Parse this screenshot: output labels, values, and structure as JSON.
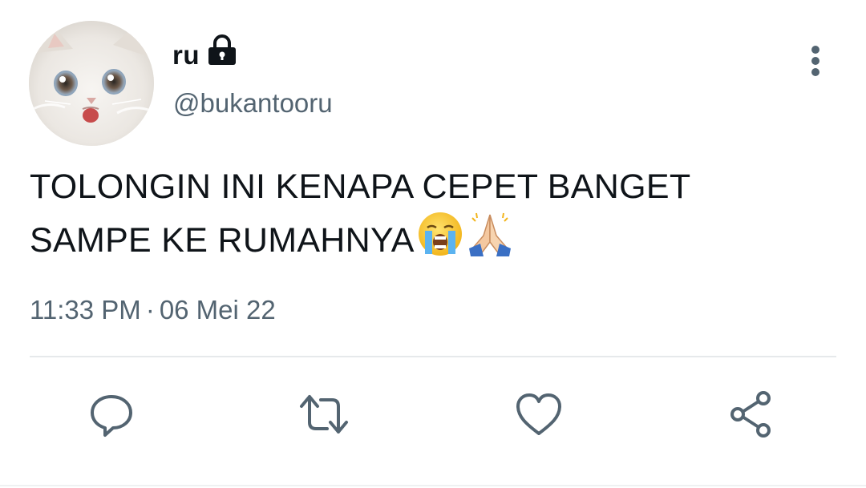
{
  "user": {
    "display_name": "ru",
    "handle": "@bukantooru",
    "protected": true,
    "avatar": "white-kitten-avatar"
  },
  "tweet": {
    "text_line1": "TOLONGIN INI KENAPA CEPET BANGET",
    "text_line2": "SAMPE KE RUMAHNYA",
    "emojis": [
      "loudly-crying-face",
      "folded-hands"
    ],
    "time": "11:33 PM",
    "separator": "·",
    "date": "06 Mei 22"
  },
  "actions": [
    "reply-icon",
    "retweet-icon",
    "like-icon",
    "share-icon"
  ],
  "icons": {
    "lock": "lock-icon",
    "more": "more-vertical-icon"
  },
  "colors": {
    "text_primary": "#0f1419",
    "text_secondary": "#536471",
    "divider": "#e6e9eb",
    "icon": "#536471"
  }
}
